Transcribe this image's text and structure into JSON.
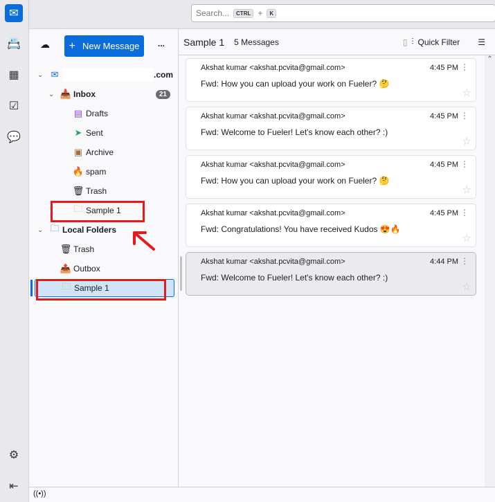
{
  "rail": {
    "icons": [
      "mail-icon",
      "address-book-icon",
      "calendar-icon",
      "tasks-icon",
      "chat-icon",
      "settings-icon",
      "collapse-icon"
    ]
  },
  "search": {
    "placeholder": "Search...",
    "key1": "CTRL",
    "plus": "+",
    "key2": "K"
  },
  "folders": {
    "new_message": "New Message",
    "more": "...",
    "account": ".com",
    "items": [
      {
        "label": "Inbox",
        "badge": "21"
      },
      {
        "label": "Drafts"
      },
      {
        "label": "Sent"
      },
      {
        "label": "Archive"
      },
      {
        "label": "spam"
      },
      {
        "label": "Trash"
      },
      {
        "label": "Sample 1"
      }
    ],
    "local": {
      "label": "Local Folders",
      "items": [
        {
          "label": "Trash"
        },
        {
          "label": "Outbox"
        },
        {
          "label": "Sample 1"
        }
      ]
    }
  },
  "list": {
    "title": "Sample 1",
    "count": "5 Messages",
    "quick_filter": "Quick Filter",
    "messages": [
      {
        "from": "Akshat kumar <akshat.pcvita@gmail.com>",
        "time": "4:45 PM",
        "subject": "Fwd: How you can upload your work on Fueler? 🤔"
      },
      {
        "from": "Akshat kumar <akshat.pcvita@gmail.com>",
        "time": "4:45 PM",
        "subject": "Fwd: Welcome to Fueler! Let's know each other? :)"
      },
      {
        "from": "Akshat kumar <akshat.pcvita@gmail.com>",
        "time": "4:45 PM",
        "subject": "Fwd: How you can upload your work on Fueler? 🤔"
      },
      {
        "from": "Akshat kumar <akshat.pcvita@gmail.com>",
        "time": "4:45 PM",
        "subject": "Fwd: Congratulations! You have received Kudos 😍🔥"
      },
      {
        "from": "Akshat kumar <akshat.pcvita@gmail.com>",
        "time": "4:44 PM",
        "subject": "Fwd: Welcome to Fueler! Let's know each other? :)"
      }
    ]
  },
  "colors": {
    "accent": "#0b6ddc",
    "annotation": "#e31b1b"
  }
}
